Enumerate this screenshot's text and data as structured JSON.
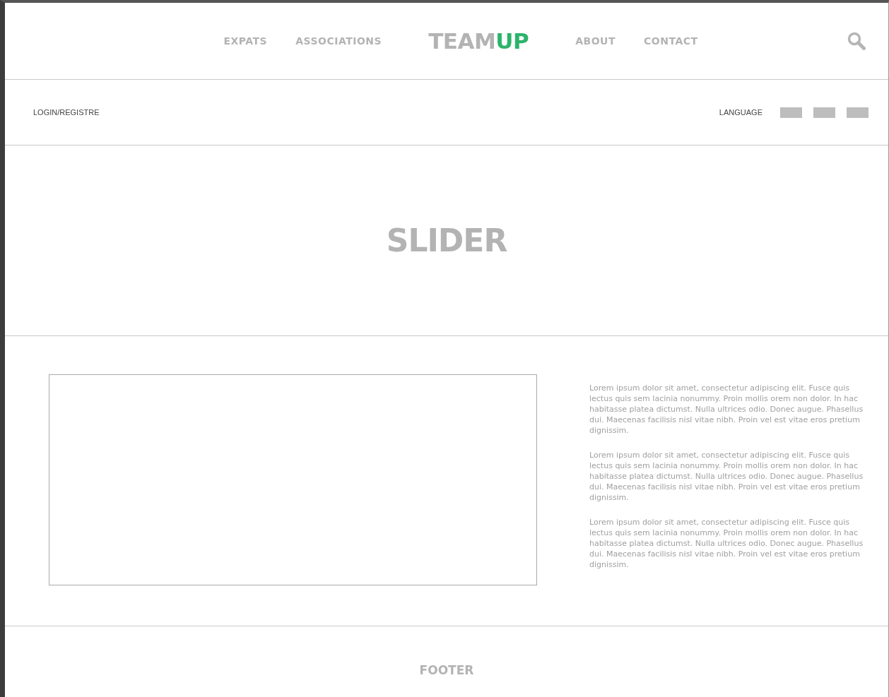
{
  "header": {
    "nav_left": [
      "EXPATS",
      "ASSOCIATIONS"
    ],
    "logo": {
      "text": "TEAM",
      "accent": "UP"
    },
    "nav_right": [
      "ABOUT",
      "CONTACT"
    ]
  },
  "subbar": {
    "login": "LOGIN/REGISTRE",
    "language_label": "LANGUAGE"
  },
  "slider": {
    "label": "SLIDER"
  },
  "content": {
    "paragraphs": [
      "Lorem ipsum dolor sit amet, consectetur adipiscing elit. Fusce quis lectus quis sem lacinia nonummy. Proin mollis orem non dolor. In hac habitasse platea dictumst. Nulla ultrices odio. Donec augue. Phasellus dui. Maecenas facilisis nisl vitae nibh. Proin vel est vitae eros pretium dignissim.",
      "Lorem ipsum dolor sit amet, consectetur adipiscing elit. Fusce quis lectus quis sem lacinia nonummy. Proin mollis orem non dolor. In hac habitasse platea dictumst. Nulla ultrices odio. Donec augue. Phasellus dui. Maecenas facilisis nisl vitae nibh. Proin vel est vitae eros pretium dignissim.",
      "Lorem ipsum dolor sit amet, consectetur adipiscing elit. Fusce quis lectus quis sem lacinia nonummy. Proin mollis orem non dolor. In hac habitasse platea dictumst. Nulla ultrices odio. Donec augue. Phasellus dui. Maecenas facilisis nisl vitae nibh. Proin vel est vitae eros pretium dignissim."
    ]
  },
  "footer": {
    "label": "FOOTER"
  }
}
